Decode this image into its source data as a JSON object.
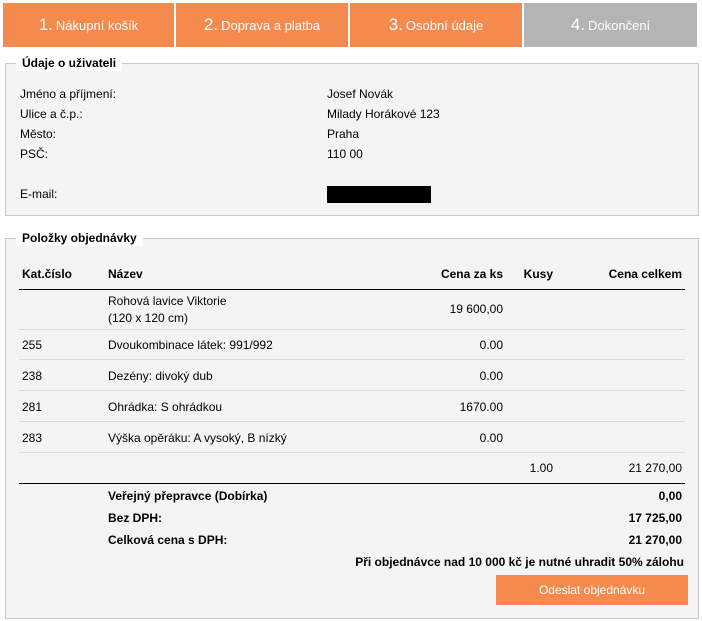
{
  "steps": [
    {
      "num": "1.",
      "label": "Nákupní košík"
    },
    {
      "num": "2.",
      "label": "Doprava a platba"
    },
    {
      "num": "3.",
      "label": "Osobní údaje"
    },
    {
      "num": "4.",
      "label": "Dokončení"
    }
  ],
  "user_section": {
    "legend": "Údaje o uživateli",
    "fields": [
      {
        "label": "Jméno a příjmení:",
        "value": "Josef Novák"
      },
      {
        "label": "Ulice a č.p.:",
        "value": "Milady Horákové 123"
      },
      {
        "label": "Město:",
        "value": "Praha"
      },
      {
        "label": "PSČ:",
        "value": "110 00"
      },
      {
        "label": "E-mail:",
        "value": ""
      }
    ]
  },
  "items_section": {
    "legend": "Položky objednávky",
    "columns": [
      "Kat.číslo",
      "Název",
      "Cena za ks",
      "Kusy",
      "Cena celkem"
    ],
    "rows": [
      {
        "cat": "",
        "name": "Rohová lavice Viktorie",
        "name2": "(120 x 120 cm)",
        "price": "19 600,00",
        "qty": "",
        "total": ""
      },
      {
        "cat": "255",
        "name": "Dvoukombinace látek: 991/992",
        "price": "0.00",
        "qty": "",
        "total": ""
      },
      {
        "cat": "238",
        "name": "Dezény: divoký dub",
        "price": "0.00",
        "qty": "",
        "total": ""
      },
      {
        "cat": "281",
        "name": "Ohrádka: S ohrádkou",
        "price": "1670.00",
        "qty": "",
        "total": ""
      },
      {
        "cat": "283",
        "name": "Výška opěráku: A vysoký, B nízký",
        "price": "0.00",
        "qty": "",
        "total": ""
      }
    ],
    "subtotal": {
      "qty": "1.00",
      "total": "21 270,00"
    },
    "summary": [
      {
        "label": "Veřejný přepravce (Dobírka)",
        "value": "0,00"
      },
      {
        "label": "Bez DPH:",
        "value": "17 725,00"
      },
      {
        "label": "Celková cena s DPH:",
        "value": "21 270,00"
      }
    ],
    "note": "Při objednávce nad 10 000 kč je nutné uhradit 50% zálohu",
    "submit_label": "Odeslat objednávku"
  },
  "colors": {
    "accent": "#f58a4e",
    "inactive": "#b4b4b4",
    "panel": "#f4f4f4"
  }
}
